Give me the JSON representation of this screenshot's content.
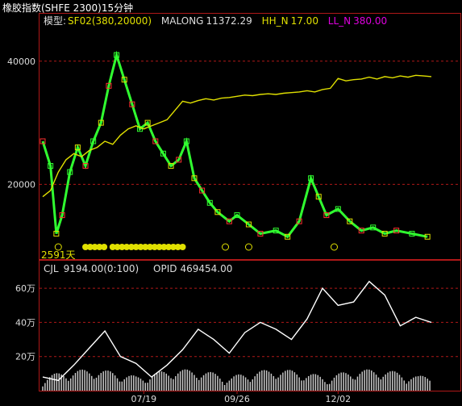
{
  "window": {
    "title": "橡胶指数(SHFE 2300)15分钟"
  },
  "legend": {
    "model_label": "模型:",
    "model": "SF02(380,20000)",
    "malong_label": "MALONG",
    "malong_value": "11372.29",
    "hh_label": "HH_N",
    "hh_value": "17.00",
    "ll_label": "LL_N",
    "ll_value": "380.00"
  },
  "sub_legend": {
    "cjl_label": "CJL",
    "cjl_value": "9194.00(0:100)",
    "opid_label": "OPID",
    "opid_value": "469454.00"
  },
  "days_label": "2591天",
  "colors": {
    "frame": "#b01818",
    "price_up": "#ff3030",
    "price_down": "#30ff30",
    "malong": "#e0e000",
    "volume": "#c8c8c8",
    "hh": "#e0e000",
    "ll": "#e000e0"
  },
  "chart_data": [
    {
      "type": "line",
      "title": "",
      "y_ticks": [
        "40000",
        "20000"
      ],
      "ylim": [
        8000,
        46000
      ],
      "series": [
        {
          "name": "MALONG",
          "x": [
            0,
            0.02,
            0.04,
            0.06,
            0.08,
            0.1,
            0.12,
            0.14,
            0.16,
            0.18,
            0.2,
            0.22,
            0.24,
            0.26,
            0.28,
            0.3,
            0.32,
            0.34,
            0.36,
            0.38,
            0.4,
            0.42,
            0.44,
            0.46,
            0.48,
            0.5,
            0.52,
            0.54,
            0.56,
            0.58,
            0.6,
            0.62,
            0.64,
            0.66,
            0.68,
            0.7,
            0.72,
            0.74,
            0.76,
            0.78,
            0.8,
            0.82,
            0.84,
            0.86,
            0.88,
            0.9,
            0.92,
            0.94,
            0.96,
            0.98,
            1.0
          ],
          "values": [
            18000,
            19000,
            22000,
            24000,
            25000,
            24500,
            25500,
            26000,
            27000,
            26500,
            28000,
            29000,
            29500,
            29000,
            29500,
            30000,
            30500,
            32000,
            33500,
            33200,
            33600,
            33900,
            33700,
            34000,
            34100,
            34300,
            34500,
            34400,
            34600,
            34700,
            34600,
            34800,
            34900,
            35000,
            35200,
            35000,
            35400,
            35600,
            37200,
            36800,
            37000,
            37100,
            37400,
            37100,
            37500,
            37300,
            37600,
            37400,
            37700,
            37600,
            37500
          ]
        }
      ]
    },
    {
      "type": "area",
      "title": "",
      "y_ticks": [
        "60万",
        "40万",
        "20万"
      ],
      "x_ticks": [
        "07/19",
        "09/26",
        "12/02"
      ],
      "ylim": [
        0,
        700000
      ],
      "series": [
        {
          "name": "OPID",
          "x": [
            0,
            0.04,
            0.08,
            0.12,
            0.16,
            0.2,
            0.24,
            0.28,
            0.32,
            0.36,
            0.4,
            0.44,
            0.48,
            0.52,
            0.56,
            0.6,
            0.64,
            0.68,
            0.72,
            0.76,
            0.8,
            0.84,
            0.88,
            0.92,
            0.96,
            1.0
          ],
          "values": [
            80000,
            60000,
            150000,
            250000,
            350000,
            200000,
            160000,
            80000,
            150000,
            240000,
            360000,
            300000,
            220000,
            340000,
            400000,
            360000,
            300000,
            420000,
            600000,
            500000,
            520000,
            640000,
            560000,
            380000,
            430000,
            400000
          ]
        }
      ]
    }
  ]
}
